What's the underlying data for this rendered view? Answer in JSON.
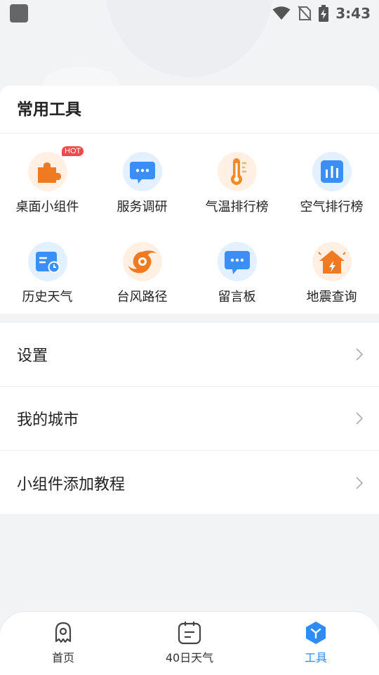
{
  "status_bar": {
    "time": "3:43",
    "icons": [
      "app-icon",
      "wifi-icon",
      "no-sim-icon",
      "battery-charging-icon"
    ]
  },
  "tools": {
    "title": "常用工具",
    "items": [
      {
        "label": "桌面小组件",
        "icon": "widget-puzzle-icon",
        "badge": "HOT",
        "color": "#f07a22"
      },
      {
        "label": "服务调研",
        "icon": "survey-chat-icon",
        "color": "#3a8ef6"
      },
      {
        "label": "气温排行榜",
        "icon": "thermometer-icon",
        "color": "#f08a24"
      },
      {
        "label": "空气排行榜",
        "icon": "bar-chart-icon",
        "color": "#3a8ef6"
      },
      {
        "label": "历史天气",
        "icon": "history-calendar-icon",
        "color": "#3a8ef6"
      },
      {
        "label": "台风路径",
        "icon": "typhoon-icon",
        "color": "#f07a22"
      },
      {
        "label": "留言板",
        "icon": "message-board-icon",
        "color": "#3a8ef6"
      },
      {
        "label": "地震查询",
        "icon": "earthquake-house-icon",
        "color": "#f07a22"
      }
    ]
  },
  "menu": {
    "items": [
      {
        "label": "设置"
      },
      {
        "label": "我的城市"
      },
      {
        "label": "小组件添加教程"
      }
    ]
  },
  "bottom_nav": {
    "items": [
      {
        "label": "首页",
        "icon": "home-icon",
        "active": false
      },
      {
        "label": "40日天气",
        "icon": "calendar-40-icon",
        "active": false
      },
      {
        "label": "工具",
        "icon": "tools-hexagon-icon",
        "active": true
      }
    ],
    "active_color": "#2f8bf5"
  }
}
